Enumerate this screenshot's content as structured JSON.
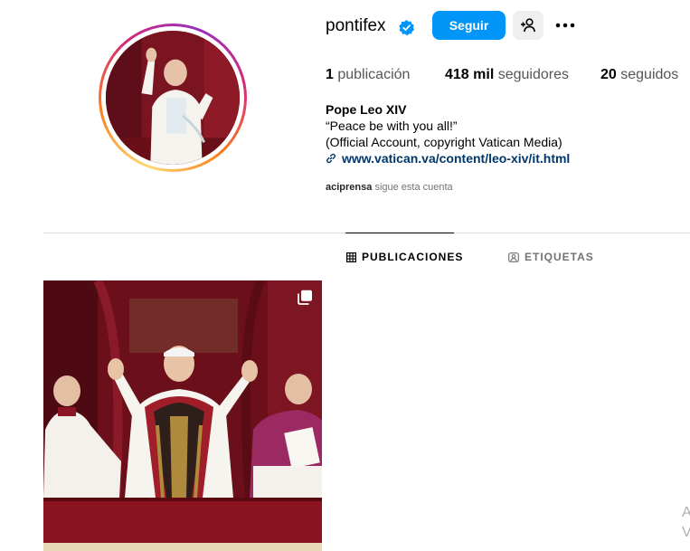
{
  "profile": {
    "username": "pontifex",
    "follow_label": "Seguir",
    "verified": true,
    "accent_color": "#0095f6"
  },
  "stats": {
    "posts_count": "1",
    "posts_label": "publicación",
    "followers_count": "418 mil",
    "followers_label": "seguidores",
    "following_count": "20",
    "following_label": "seguidos"
  },
  "bio": {
    "name": "Pope Leo XIV",
    "line1": "“Peace be with you all!”",
    "line2": "(Official Account, copyright Vatican Media)",
    "link": "www.vatican.va/content/leo-xiv/it.html"
  },
  "followed_by": {
    "user": "aciprensa",
    "text": "sigue esta cuenta"
  },
  "tabs": [
    {
      "label": "PUBLICACIONES",
      "icon": "grid-icon",
      "active": true
    },
    {
      "label": "ETIQUETAS",
      "icon": "tag-icon",
      "active": false
    }
  ],
  "posts": [
    {
      "type": "carousel",
      "icon": "multiple-images-icon"
    }
  ],
  "edge_text": [
    "A",
    "V"
  ]
}
